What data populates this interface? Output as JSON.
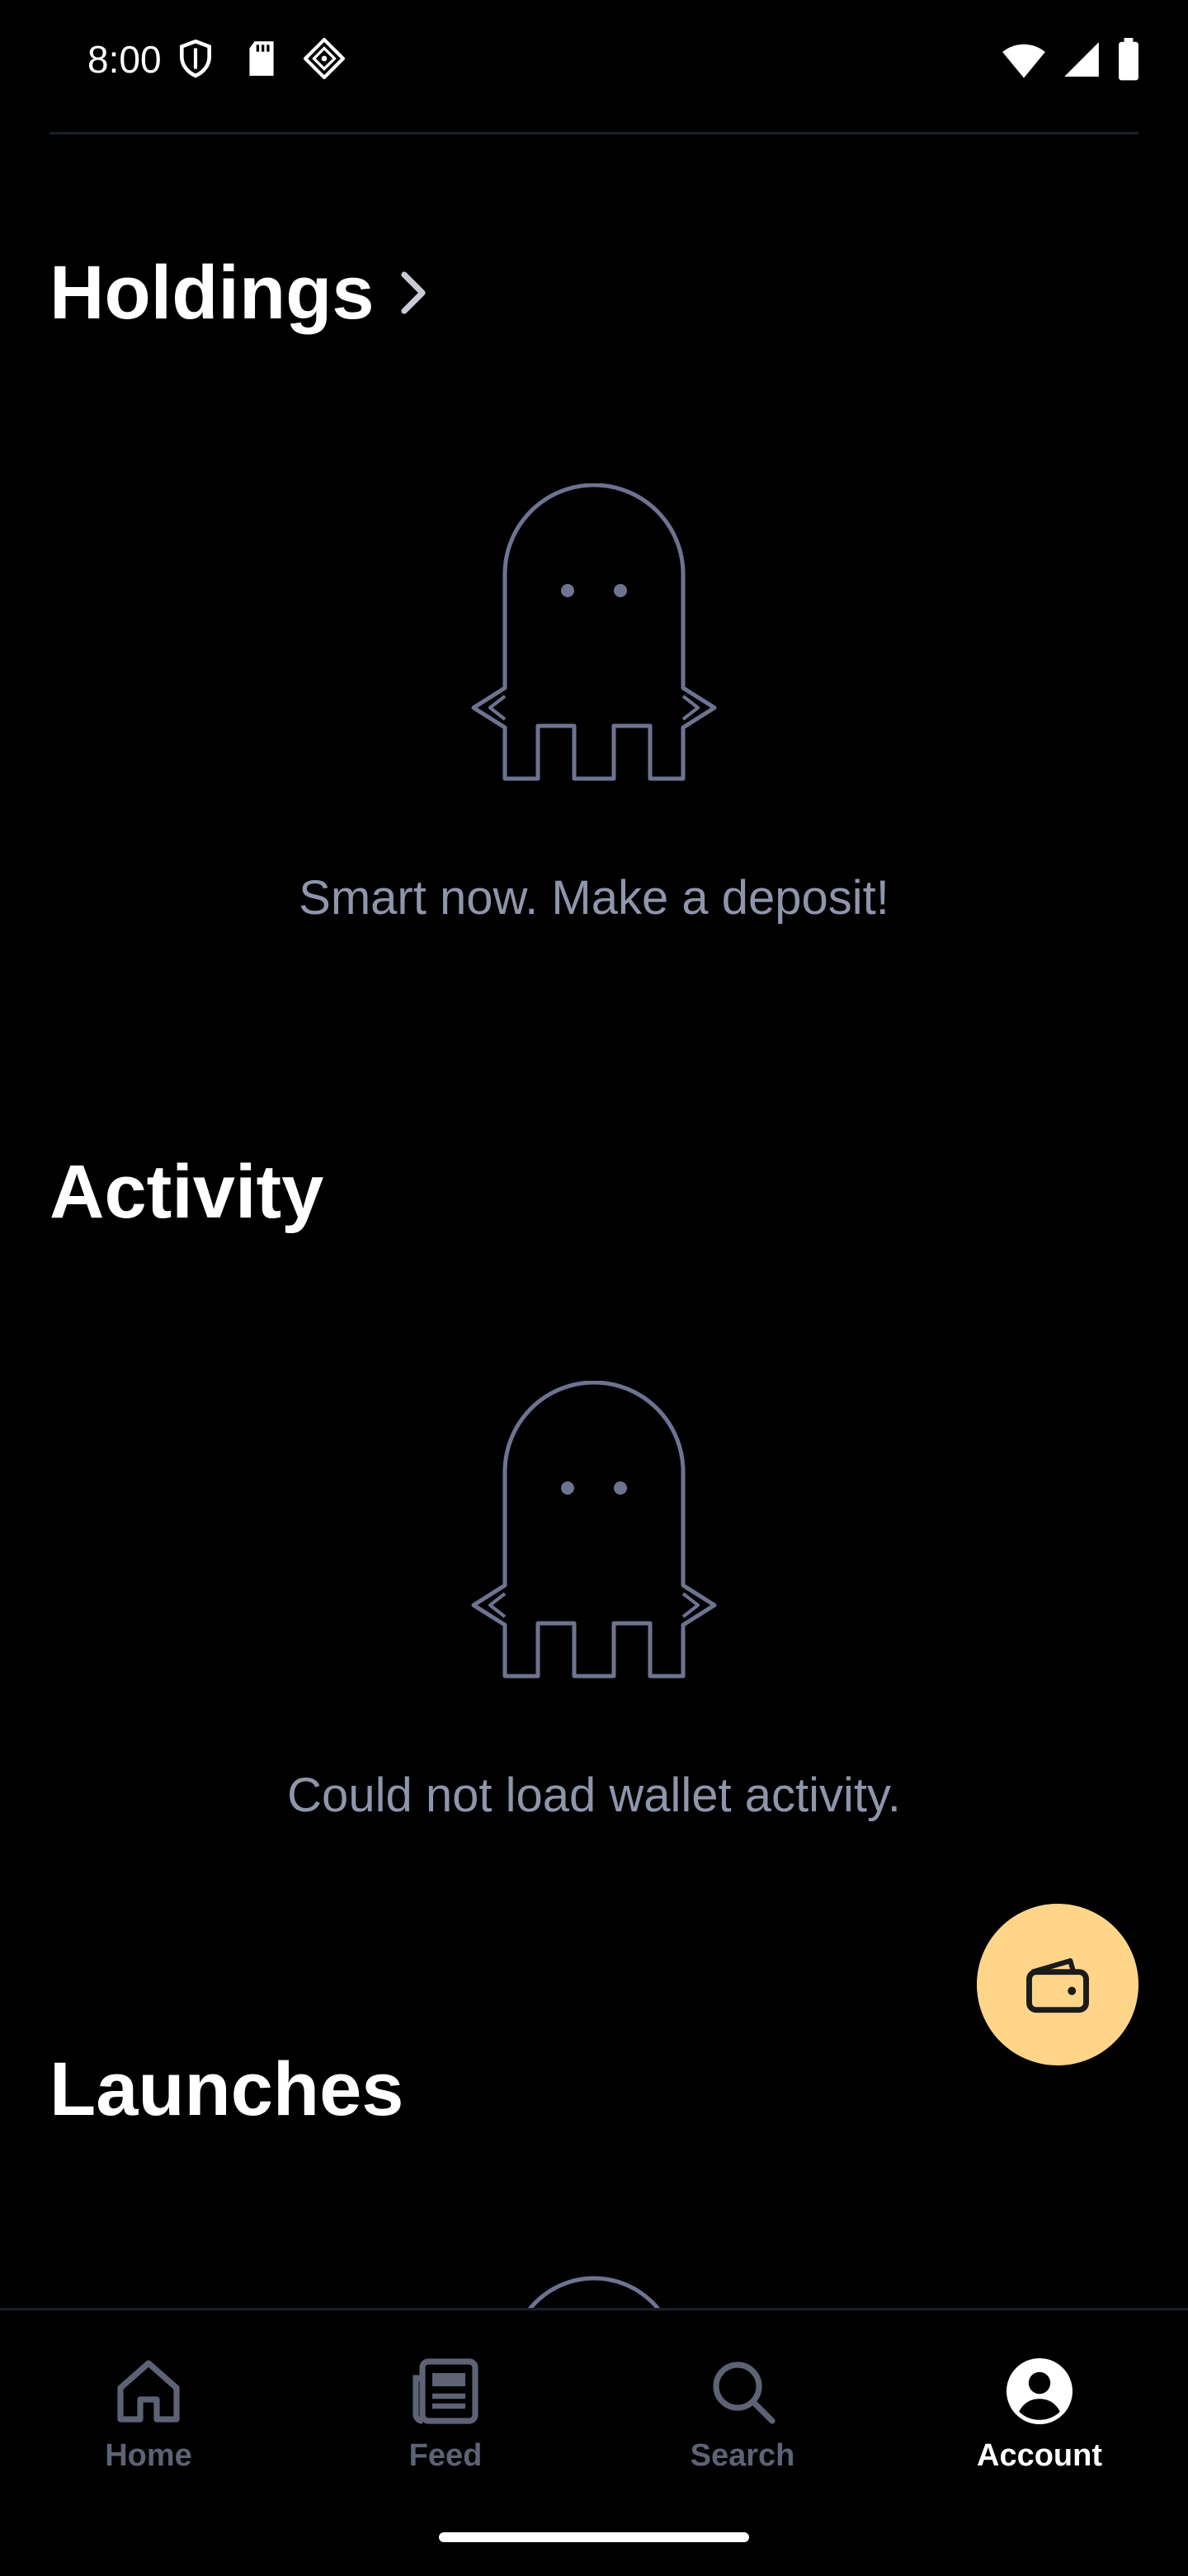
{
  "status_bar": {
    "time": "8:00",
    "left_icons": [
      "shield-icon",
      "sd-card-icon",
      "diamond-app-icon"
    ],
    "right_icons": [
      "wifi-icon",
      "signal-icon",
      "battery-icon"
    ]
  },
  "holdings": {
    "title": "Holdings",
    "empty_message": "Smart now. Make a deposit!"
  },
  "activity": {
    "title": "Activity",
    "empty_message": "Could not load wallet activity."
  },
  "launches": {
    "title": "Launches"
  },
  "fab": {
    "icon": "wallet-icon",
    "color": "#ffd58a"
  },
  "bottom_nav": {
    "items": [
      {
        "label": "Home",
        "icon": "home-icon",
        "active": false
      },
      {
        "label": "Feed",
        "icon": "feed-icon",
        "active": false
      },
      {
        "label": "Search",
        "icon": "search-icon",
        "active": false
      },
      {
        "label": "Account",
        "icon": "account-icon",
        "active": true
      }
    ]
  },
  "colors": {
    "background": "#000000",
    "muted_text": "#8f95ab",
    "inactive_nav": "#5d6275",
    "ghost_stroke": "#6e7391",
    "accent": "#ffd58a"
  }
}
